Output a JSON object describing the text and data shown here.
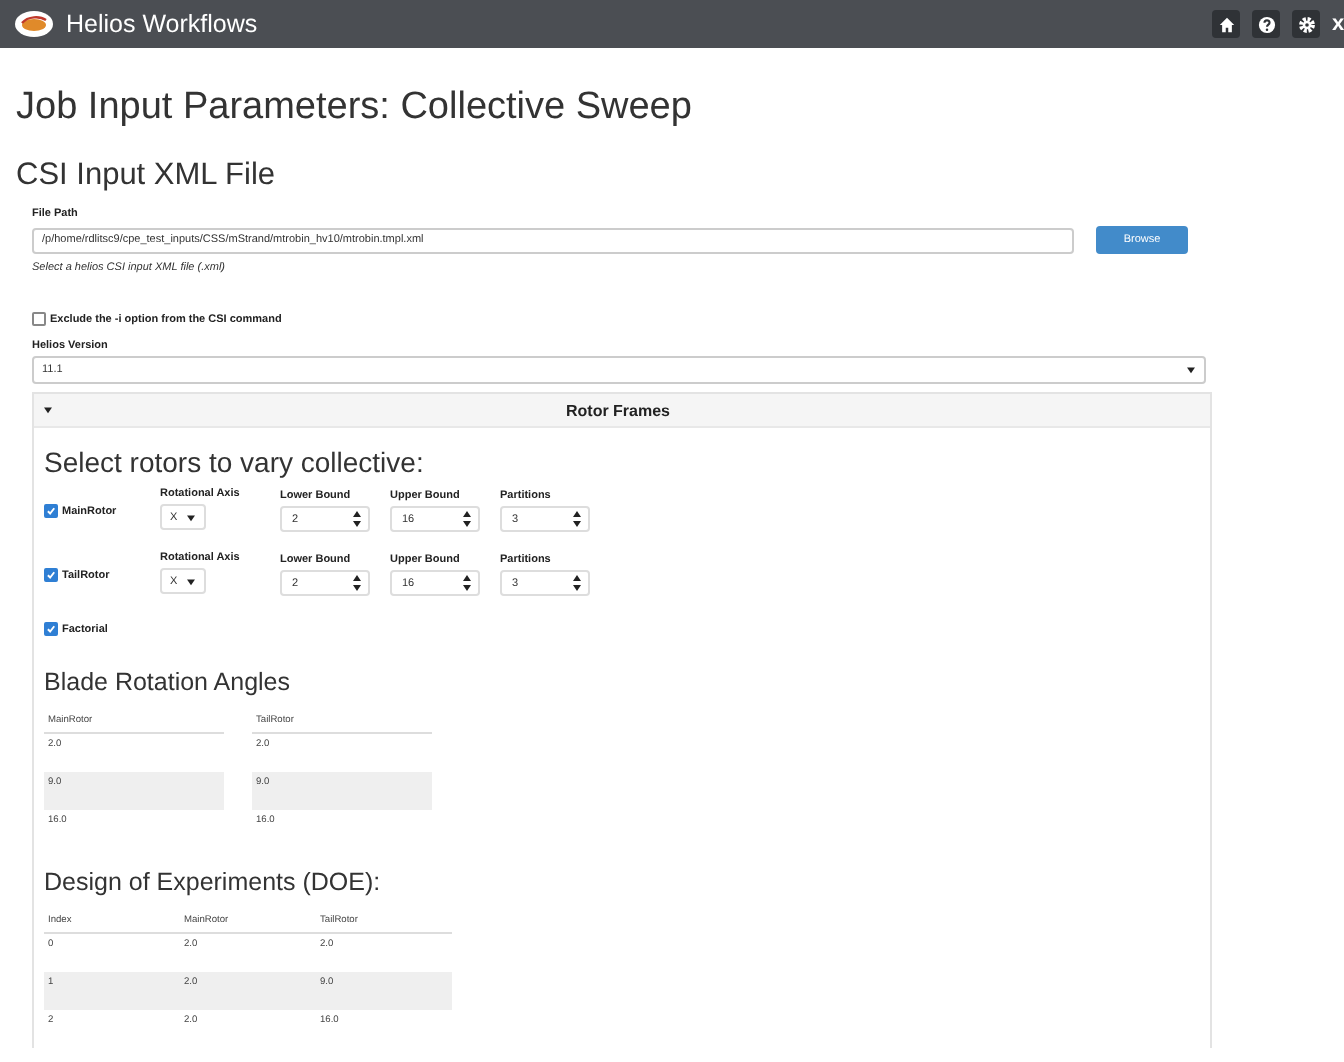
{
  "app": {
    "title": "Helios Workflows",
    "close_label": "x"
  },
  "page_title": "Job Input Parameters: Collective Sweep",
  "section_title": "CSI Input XML File",
  "file_path": {
    "label": "File Path",
    "value": "/p/home/rdlitsc9/cpe_test_inputs/CSS/mStrand/mtrobin_hv10/mtrobin.tmpl.xml",
    "hint": "Select a helios CSI input XML file (.xml)"
  },
  "browse_button": "Browse",
  "exclude_option": {
    "label": "Exclude the -i option from the CSI command",
    "checked": false
  },
  "helios_version": {
    "label": "Helios Version",
    "value": "11.1"
  },
  "panel": {
    "title": "Rotor Frames",
    "expanded": true,
    "rotor_heading": "Select rotors to vary collective:",
    "rotors": [
      {
        "name": "MainRotor",
        "checked": true,
        "axis_label": "Rotational Axis",
        "axis": "X",
        "lower_label": "Lower Bound",
        "lower": "2",
        "upper_label": "Upper Bound",
        "upper": "16",
        "partitions_label": "Partitions",
        "partitions": "3"
      },
      {
        "name": "TailRotor",
        "checked": true,
        "axis_label": "Rotational Axis",
        "axis": "X",
        "lower_label": "Lower Bound",
        "lower": "2",
        "upper_label": "Upper Bound",
        "upper": "16",
        "partitions_label": "Partitions",
        "partitions": "3"
      }
    ],
    "factorial": {
      "label": "Factorial",
      "checked": true
    },
    "angles": {
      "title": "Blade Rotation Angles",
      "columns": [
        "MainRotor",
        "TailRotor"
      ],
      "rows": [
        [
          "2.0",
          "2.0"
        ],
        [
          "9.0",
          "9.0"
        ],
        [
          "16.0",
          "16.0"
        ]
      ]
    },
    "doe": {
      "title": "Design of Experiments (DOE):",
      "columns": [
        "Index",
        "MainRotor",
        "TailRotor"
      ],
      "rows": [
        [
          "0",
          "2.0",
          "2.0"
        ],
        [
          "1",
          "2.0",
          "9.0"
        ],
        [
          "2",
          "2.0",
          "16.0"
        ]
      ]
    }
  }
}
